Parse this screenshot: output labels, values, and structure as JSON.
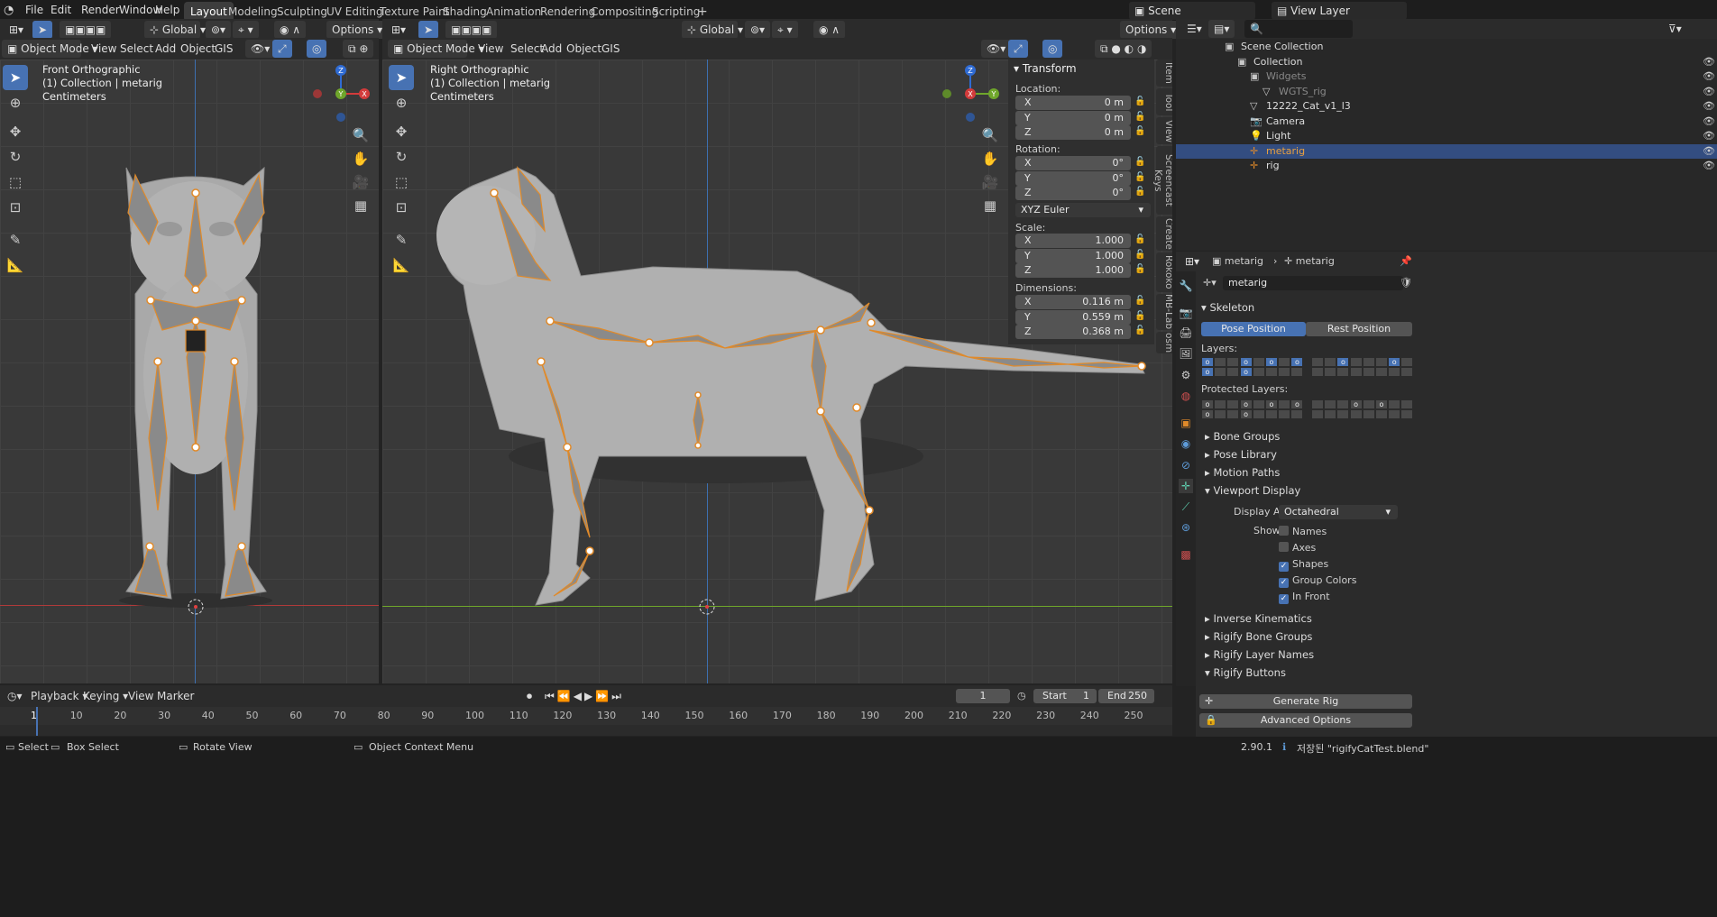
{
  "menu": [
    "File",
    "Edit",
    "Render",
    "Window",
    "Help"
  ],
  "workspaces": [
    "Layout",
    "Modeling",
    "Sculpting",
    "UV Editing",
    "Texture Paint",
    "Shading",
    "Animation",
    "Rendering",
    "Compositing",
    "Scripting"
  ],
  "scene": "Scene",
  "view_layer": "View Layer",
  "top_hdr": {
    "transform": "Global",
    "options": "Options"
  },
  "left_vp": {
    "mode": "Object Mode",
    "menus": [
      "View",
      "Select",
      "Add",
      "Object",
      "GIS"
    ],
    "line1": "Front Orthographic",
    "line2": "(1) Collection | metarig",
    "line3": "Centimeters"
  },
  "right_vp": {
    "mode": "Object Mode",
    "menus": [
      "View",
      "Select",
      "Add",
      "Object",
      "GIS"
    ],
    "line1": "Right Orthographic",
    "line2": "(1) Collection | metarig",
    "line3": "Centimeters",
    "transform": "Global",
    "options": "Options"
  },
  "gizmo": {
    "z": "Z",
    "y": "Y",
    "x": "X"
  },
  "npanel": {
    "title": "Transform",
    "location": "Location:",
    "rotation": "Rotation:",
    "scale": "Scale:",
    "dimensions": "Dimensions:",
    "euler": "XYZ Euler",
    "loc": [
      [
        "X",
        "0 m"
      ],
      [
        "Y",
        "0 m"
      ],
      [
        "Z",
        "0 m"
      ]
    ],
    "rot": [
      [
        "X",
        "0°"
      ],
      [
        "Y",
        "0°"
      ],
      [
        "Z",
        "0°"
      ]
    ],
    "scl": [
      [
        "X",
        "1.000"
      ],
      [
        "Y",
        "1.000"
      ],
      [
        "Z",
        "1.000"
      ]
    ],
    "dim": [
      [
        "X",
        "0.116 m"
      ],
      [
        "Y",
        "0.559 m"
      ],
      [
        "Z",
        "0.368 m"
      ]
    ],
    "tabs": [
      "Item",
      "Tool",
      "View",
      "Screencast Keys",
      "Create",
      "Rokoko",
      "MB-Lab",
      "osm"
    ]
  },
  "outliner": {
    "rows": [
      "Scene Collection",
      "Collection",
      "Widgets",
      "WGTS_rig",
      "12222_Cat_v1_l3",
      "Camera",
      "Light",
      "metarig",
      "rig"
    ]
  },
  "props": {
    "obj": "metarig",
    "data": "metarig",
    "name": "metarig",
    "skeleton": "Skeleton",
    "pose_btn": "Pose Position",
    "rest_btn": "Rest Position",
    "layers": "Layers:",
    "protected": "Protected Layers:",
    "panels_a": [
      "Bone Groups",
      "Pose Library",
      "Motion Paths"
    ],
    "viewport_display": "Viewport Display",
    "display_as_lbl": "Display As",
    "display_as": "Octahedral",
    "show": "Show",
    "checks": [
      [
        "Names",
        false
      ],
      [
        "Axes",
        false
      ],
      [
        "Shapes",
        true
      ],
      [
        "Group Colors",
        true
      ],
      [
        "In Front",
        true
      ]
    ],
    "panels_b": [
      "Inverse Kinematics",
      "Rigify Bone Groups",
      "Rigify Layer Names"
    ],
    "rigify_buttons": "Rigify Buttons",
    "generate": "Generate Rig",
    "advanced": "Advanced Options"
  },
  "timeline": {
    "menus": [
      "Playback",
      "Keying",
      "View",
      "Marker"
    ],
    "frame": "1",
    "start_lbl": "Start",
    "start": "1",
    "end_lbl": "End",
    "end": "250",
    "ticks": [
      "1",
      "10",
      "20",
      "30",
      "40",
      "50",
      "60",
      "70",
      "80",
      "90",
      "100",
      "110",
      "120",
      "130",
      "140",
      "150",
      "160",
      "170",
      "180",
      "190",
      "200",
      "210",
      "220",
      "230",
      "240",
      "250"
    ]
  },
  "status": {
    "select": "Select",
    "box": "Box Select",
    "rotate": "Rotate View",
    "ctx": "Object Context Menu",
    "version": "2.90.1",
    "saved": "저장된 \"rigifyCatTest.blend\""
  }
}
